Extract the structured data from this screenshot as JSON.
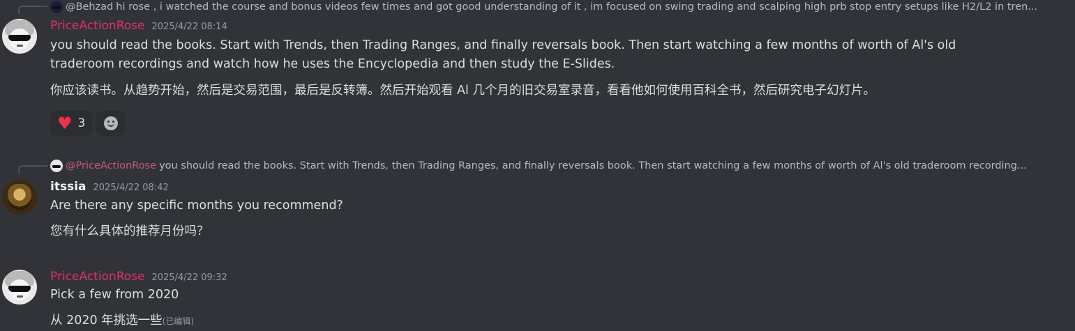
{
  "messages": [
    {
      "reply": {
        "mention": "@Behzad",
        "text": "hi rose , i watched the course and bonus videos few times and got good understanding of it , im focused on swing trading and scalping high prb stop entry setups like H2/L2 in tren..."
      },
      "author": "PriceActionRose",
      "timestamp": "2025/4/22 08:14",
      "lines": [
        "you should read the books. Start with Trends, then Trading Ranges, and finally reversals book. Then start watching a few months of worth of Al's old traderoom recordings and watch how he uses the Encyclopedia and then study the E-Slides.",
        "你应该读书。从趋势开始，然后是交易范围，最后是反转簿。然后开始观看 Al 几个月的旧交易室录音，看看他如何使用百科全书，然后研究电子幻灯片。"
      ],
      "reactions": [
        {
          "icon": "heart-icon",
          "count": "3"
        }
      ]
    },
    {
      "reply": {
        "mention": "@PriceActionRose",
        "text": "you should read the books. Start with Trends, then Trading Ranges, and finally reversals book. Then start watching a few months of worth of Al's old traderoom recording..."
      },
      "author": "itssia",
      "timestamp": "2025/4/22 08:42",
      "lines": [
        "Are there any specific months you recommend?",
        "您有什么具体的推荐月份吗？"
      ]
    },
    {
      "author": "PriceActionRose",
      "timestamp": "2025/4/22 09:32",
      "lines": [
        "Pick a few from 2020",
        "从 2020 年挑选一些"
      ],
      "edited": "(已编辑)"
    }
  ],
  "colors": {
    "background": "#313338",
    "rose_name": "#e0306a",
    "heart": "#e8334a"
  }
}
